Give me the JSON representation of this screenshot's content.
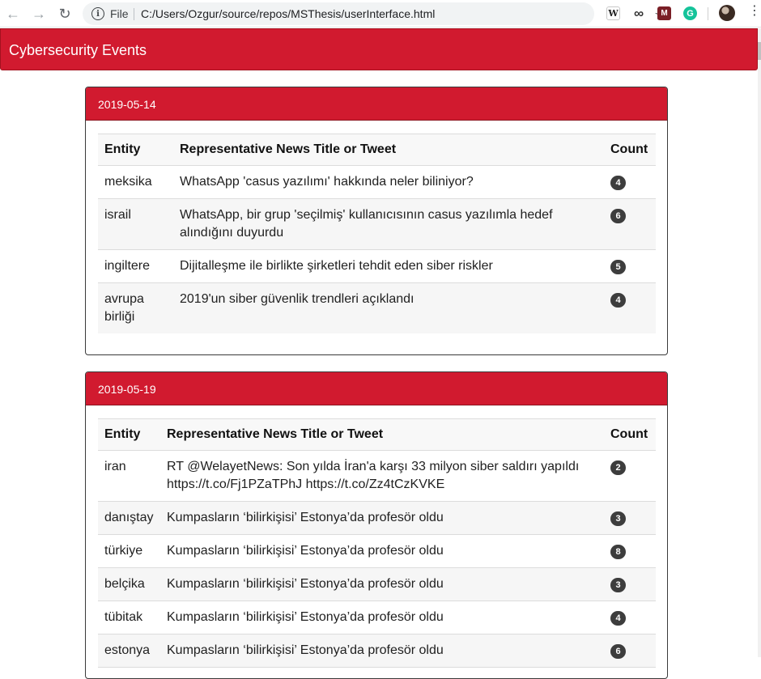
{
  "browser": {
    "file_label": "File",
    "url": "C:/Users/Ozgur/source/repos/MSThesis/userInterface.html",
    "extensions": {
      "w": "W",
      "m": "M",
      "g": "G"
    }
  },
  "page": {
    "title": "Cybersecurity Events"
  },
  "columns": {
    "entity": "Entity",
    "title": "Representative News Title or Tweet",
    "count": "Count"
  },
  "events": [
    {
      "date": "2019-05-14",
      "rows": [
        {
          "entity": "meksika",
          "title": "WhatsApp 'casus yazılımı' hakkında neler biliniyor?",
          "count": "4"
        },
        {
          "entity": "israil",
          "title": "WhatsApp, bir grup 'seçilmiş' kullanıcısının casus yazılımla hedef alındığını duyurdu",
          "count": "6"
        },
        {
          "entity": "ingiltere",
          "title": "Dijitalleşme ile birlikte şirketleri tehdit eden siber riskler",
          "count": "5"
        },
        {
          "entity": "avrupa birliği",
          "title": "2019'un siber güvenlik trendleri açıklandı",
          "count": "4"
        }
      ]
    },
    {
      "date": "2019-05-19",
      "rows": [
        {
          "entity": "iran",
          "title": "RT @WelayetNews: Son yılda İran'a karşı 33 milyon siber saldırı yapıldı https://t.co/Fj1PZaTPhJ https://t.co/Zz4tCzKVKE",
          "count": "2"
        },
        {
          "entity": "danıştay",
          "title": "Kumpasların ‘bilirkişisi’ Estonya’da profesör oldu",
          "count": "3"
        },
        {
          "entity": "türkiye",
          "title": "Kumpasların ‘bilirkişisi’ Estonya’da profesör oldu",
          "count": "8"
        },
        {
          "entity": "belçika",
          "title": "Kumpasların ‘bilirkişisi’ Estonya’da profesör oldu",
          "count": "3"
        },
        {
          "entity": "tübitak",
          "title": "Kumpasların ‘bilirkişisi’ Estonya’da profesör oldu",
          "count": "4"
        },
        {
          "entity": "estonya",
          "title": "Kumpasların ‘bilirkişisi’ Estonya’da profesör oldu",
          "count": "6"
        }
      ]
    }
  ],
  "colors": {
    "brand_red": "#d11a2f",
    "badge": "#3d3d3d"
  }
}
